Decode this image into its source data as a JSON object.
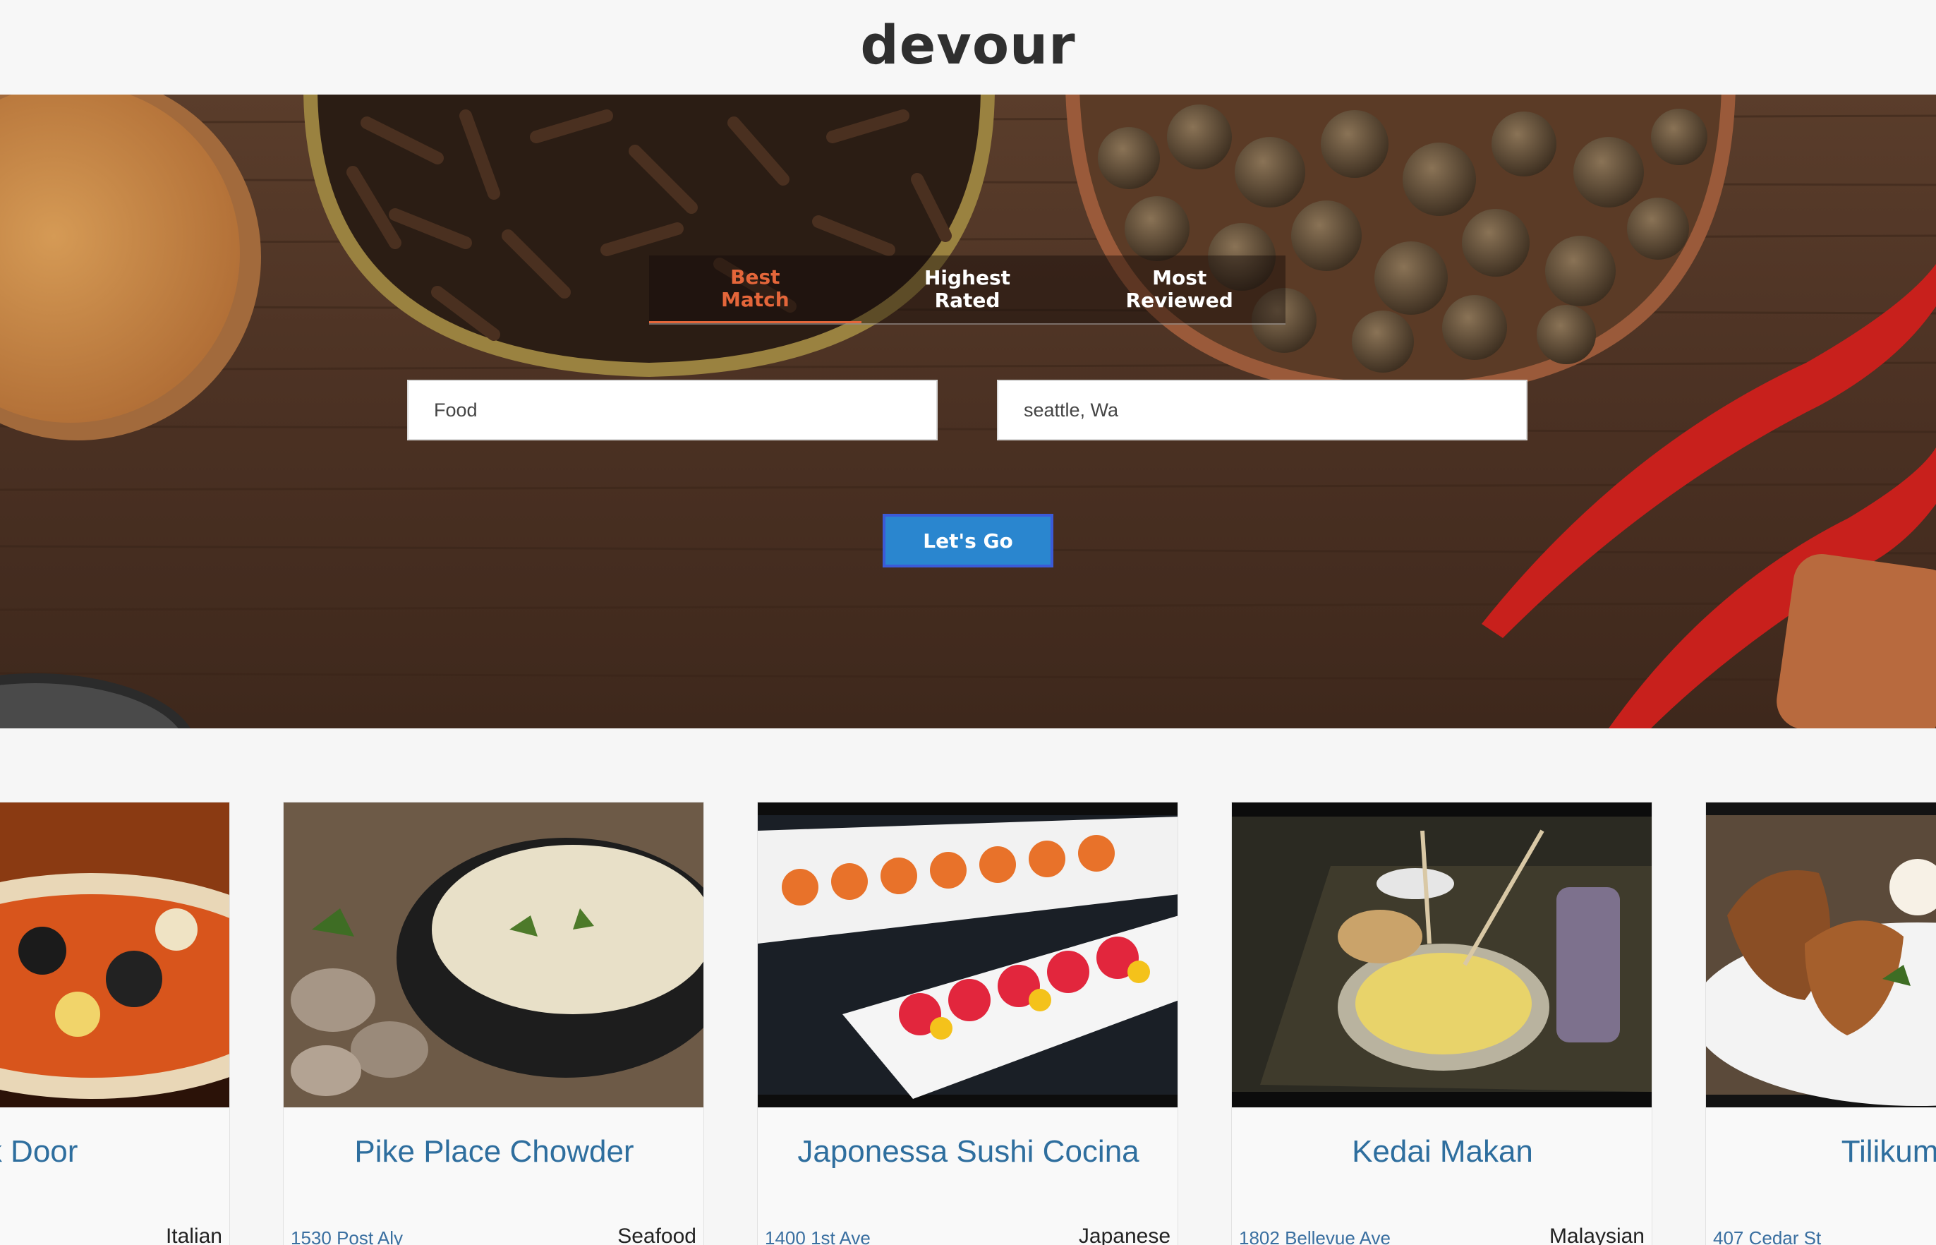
{
  "app": {
    "logo": "devour"
  },
  "tabs": [
    {
      "label": "Best\nMatch",
      "active": true
    },
    {
      "label": "Highest\nRated",
      "active": false
    },
    {
      "label": "Most\nReviewed",
      "active": false
    }
  ],
  "search": {
    "term_value": "Food",
    "location_value": "seattle, Wa",
    "submit_label": "Let's Go"
  },
  "colors": {
    "accent_orange": "#e4663a",
    "button_blue": "#2a86cf",
    "link_blue": "#2e6e9e"
  },
  "restaurants": [
    {
      "name": "ink Door",
      "address": "",
      "category": "Italian",
      "image": "seafood-stew-photo"
    },
    {
      "name": "Pike Place Chowder",
      "address": "1530 Post Aly",
      "category": "Seafood",
      "image": "clam-chowder-photo"
    },
    {
      "name": "Japonessa Sushi Cocina",
      "address": "1400 1st Ave",
      "category": "Japanese",
      "image": "sushi-rolls-photo"
    },
    {
      "name": "Kedai Makan",
      "address": "1802 Bellevue Ave",
      "category": "Malaysian",
      "image": "noodle-dish-photo"
    },
    {
      "name": "Tilikum Pla",
      "address": "407 Cedar St",
      "category": "",
      "image": "baked-pastry-photo"
    }
  ]
}
